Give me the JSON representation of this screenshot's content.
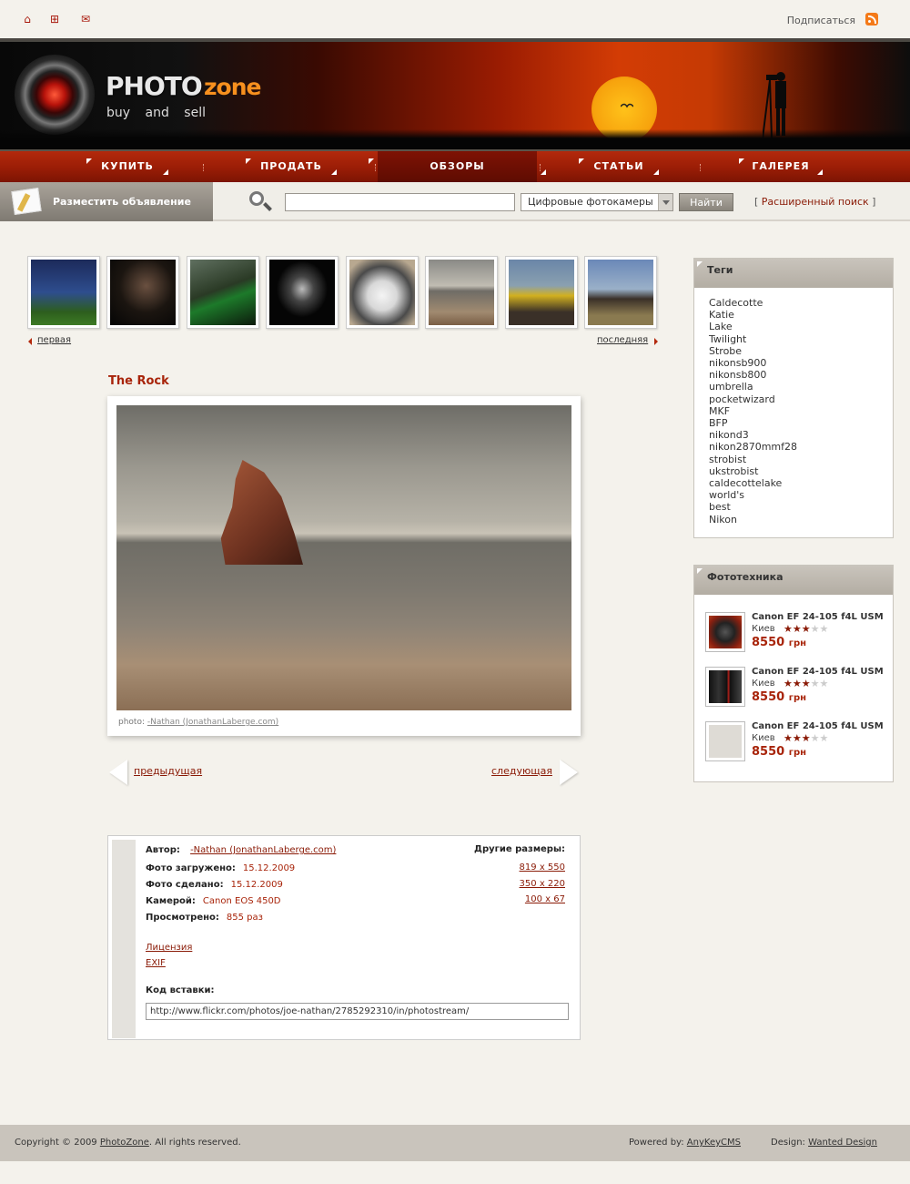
{
  "topbar": {
    "home_icon": "home-icon",
    "add_icon": "add-icon",
    "mail_icon": "mail-icon",
    "subscribe_label": "Подписаться",
    "rss_icon": "rss-icon"
  },
  "header": {
    "logo_word1": "PHOTO",
    "logo_word2": "zone",
    "logo_tagline": "buy and sell"
  },
  "nav": {
    "items": [
      {
        "label": "КУПИТЬ"
      },
      {
        "label": "ПРОДАТЬ"
      },
      {
        "label": "ОБЗОРЫ"
      },
      {
        "label": "СТАТЬИ"
      },
      {
        "label": "ГАЛЕРЕЯ"
      }
    ],
    "active": "ОБЗОРЫ"
  },
  "postbar": {
    "label": "Разместить объявление"
  },
  "search": {
    "value": "",
    "category": "Цифровые фотокамеры",
    "button": "Найти",
    "advanced_label": "Расширенный поиск",
    "bracket_open": "[",
    "bracket_close": "]"
  },
  "thumbnails": {
    "first_label": "первая",
    "last_label": "последняя"
  },
  "photo": {
    "title": "The Rock",
    "credit_prefix": "photo:",
    "credit_author": "-Nathan (JonathanLaberge.com)",
    "prev_label": "предыдущая",
    "next_label": "следующая"
  },
  "info": {
    "author_label": "Автор:",
    "author_value": "-Nathan (JonathanLaberge.com)",
    "uploaded_label": "Фото загружено:",
    "uploaded_value": "15.12.2009",
    "taken_label": "Фото сделано:",
    "taken_value": "15.12.2009",
    "camera_label": "Камерой:",
    "camera_value": "Canon EOS 450D",
    "views_label": "Просмотрено:",
    "views_value": "855 раз",
    "sizes_label": "Другие размеры:",
    "sizes": [
      "819 x 550",
      "350 x 220",
      "100 x 67"
    ],
    "license_label": "Лицензия",
    "exif_label": "EXIF",
    "embed_label": "Код вставки:",
    "embed_value": "http://www.flickr.com/photos/joe-nathan/2785292310/in/photostream/"
  },
  "sidebar": {
    "tags_title": "Теги",
    "tags": [
      "Caldecotte",
      "Katie",
      "Lake",
      "Twilight",
      "Strobe",
      "nikonsb900",
      "nikonsb800",
      "umbrella",
      "pocketwizard",
      "MKF",
      "BFP",
      "nikond3",
      "nikon2870mmf28",
      "strobist",
      "ukstrobist",
      "caldecottelake",
      "world's",
      "best",
      "Nikon"
    ],
    "gear_title": "Фототехника",
    "products": [
      {
        "name": "Canon EF 24-105 f4L USM",
        "city": "Киев",
        "rating": 2.5,
        "price": "8550",
        "currency": "грн"
      },
      {
        "name": "Canon EF 24-105 f4L USM",
        "city": "Киев",
        "rating": 2.5,
        "price": "8550",
        "currency": "грн"
      },
      {
        "name": "Canon EF 24-105 f4L USM",
        "city": "Киев",
        "rating": 2.5,
        "price": "8550",
        "currency": "грн"
      }
    ]
  },
  "footer": {
    "copyright_prefix": "Copyright © 2009",
    "copyright_link": "PhotoZone",
    "copyright_suffix": ". All rights reserved.",
    "powered_prefix": "Powered by:",
    "powered_link": "AnyKeyCMS",
    "design_prefix": "Design:",
    "design_link": "Wanted Design"
  },
  "colors": {
    "accent": "#a8240a",
    "nav_red": "#9a1d06",
    "sidebar_head": "#c9c4bc"
  }
}
